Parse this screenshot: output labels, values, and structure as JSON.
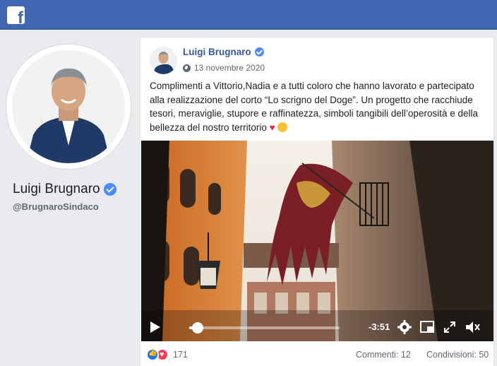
{
  "topbar": {
    "logo_icon": "facebook-f-logo",
    "brand_color": "#4267b2"
  },
  "profile": {
    "name": "Luigi Brugnaro",
    "handle": "@BrugnaroSindaco",
    "verified": true
  },
  "post": {
    "author": "Luigi Brugnaro",
    "date": "13 novembre 2020",
    "privacy_icon": "globe-icon",
    "text": "Complimenti a Vittorio,Nadia e a tutti coloro che hanno lavorato e partecipato alla realizzazione del corto “Lo scrigno del Doge”. Un progetto che racchiude tesori, meraviglie, stupore e raffinatezza, simboli tangibili dell’operosità e della bellezza del nostro territorio",
    "video": {
      "time_remaining": "-3:51",
      "progress": 0.03
    },
    "reactions_count": "171",
    "comments": "Commenti: 12",
    "shares": "Condivisioni: 50"
  }
}
